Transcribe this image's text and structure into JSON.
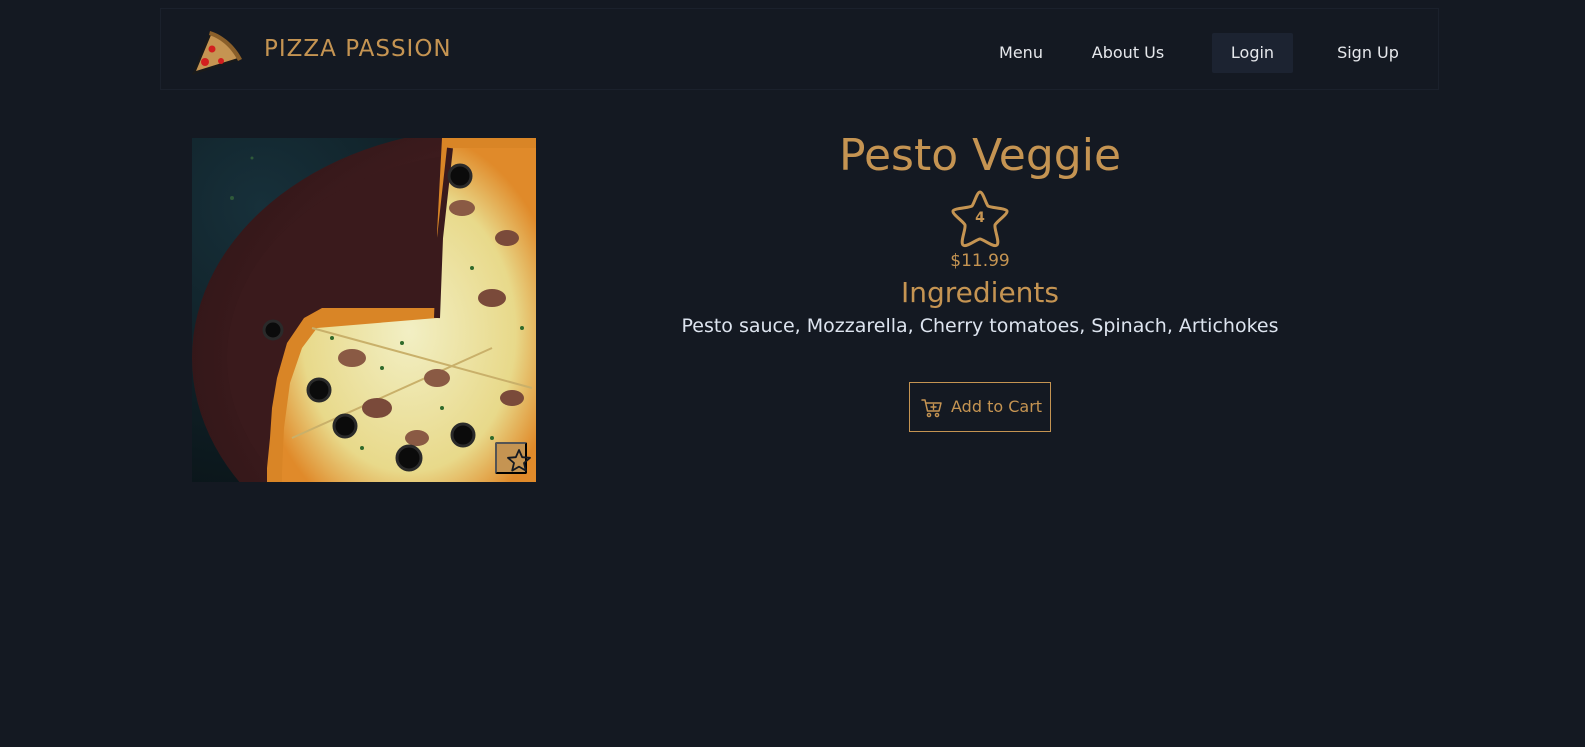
{
  "brand": {
    "name": "PIZZA PASSION",
    "accent_color": "#c59452",
    "logo_icon": "pizza-slice-icon"
  },
  "nav": {
    "items": [
      {
        "label": "Menu",
        "active": false
      },
      {
        "label": "About Us",
        "active": false
      },
      {
        "label": "Login",
        "active": true
      },
      {
        "label": "Sign Up",
        "active": false
      }
    ]
  },
  "product": {
    "name": "Pesto Veggie",
    "rating": "4",
    "rating_icon": "star-outline-icon",
    "price": "$11.99",
    "ingredients_heading": "Ingredients",
    "ingredients": "Pesto sauce, Mozzarella, Cherry tomatoes, Spinach, Artichokes",
    "favorite_icon": "star-outline-icon",
    "image_alt": "pizza-photo"
  },
  "actions": {
    "add_to_cart_label": "Add to Cart",
    "cart_icon": "cart-plus-icon"
  },
  "colors": {
    "background": "#141922",
    "accent": "#c59452",
    "text": "#dde4ef",
    "nav_active_bg": "#1c2331"
  }
}
